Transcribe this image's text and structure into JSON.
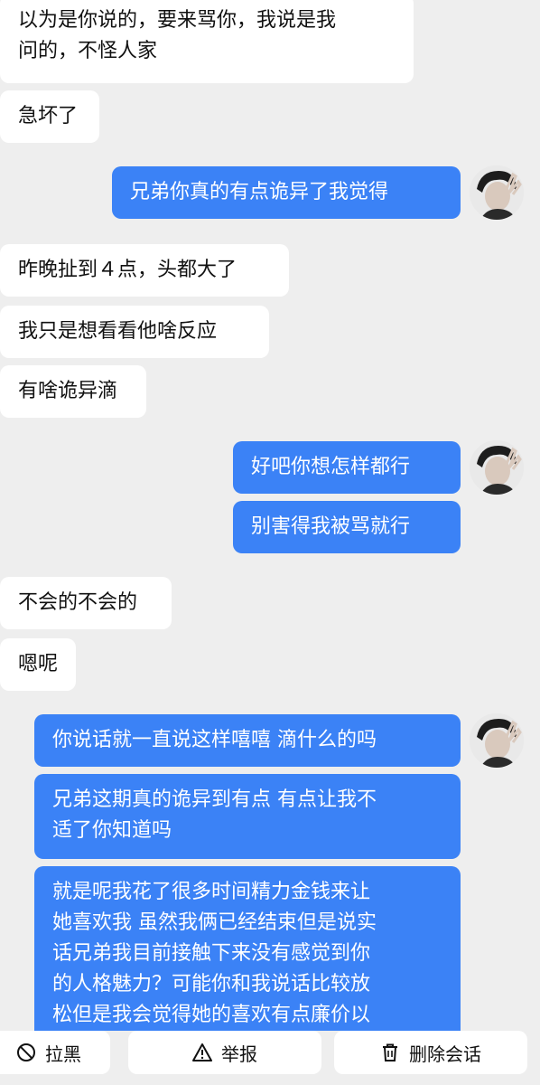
{
  "messages": [
    {
      "side": "in",
      "text": "以为是你说的，要来骂你，我说是我\n问的，不怪人家"
    },
    {
      "side": "in",
      "text": "急坏了"
    },
    {
      "side": "out",
      "text": "兄弟你真的有点诡异了我觉得"
    },
    {
      "side": "in",
      "text": "昨晚扯到４点，头都大了"
    },
    {
      "side": "in",
      "text": "我只是想看看他啥反应"
    },
    {
      "side": "in",
      "text": "有啥诡异滴"
    },
    {
      "side": "out",
      "text": "好吧你想怎样都行"
    },
    {
      "side": "out",
      "text": "别害得我被骂就行"
    },
    {
      "side": "in",
      "text": "不会的不会的"
    },
    {
      "side": "in",
      "text": "嗯呢"
    },
    {
      "side": "out",
      "text": "你说话就一直说这样嘻嘻 滴什么的吗"
    },
    {
      "side": "out",
      "text": "兄弟这期真的诡异到有点 有点让我不\n适了你知道吗"
    },
    {
      "side": "out",
      "text": "就是呢我花了很多时间精力金钱来让\n她喜欢我 虽然我俩已经结束但是说实\n话兄弟我目前接触下来没有感觉到你\n的人格魅力？可能你和我说话比较放\n松但是我会觉得她的喜欢有点廉价以"
    }
  ],
  "bottom_bar": {
    "block_label": "拉黑",
    "report_label": "举报",
    "delete_label": "删除会话"
  },
  "colors": {
    "background": "#eeeeee",
    "outgoing_bubble": "#3b82f6",
    "incoming_bubble": "#ffffff"
  },
  "icons": [
    "block-icon",
    "warning-icon",
    "trash-icon",
    "avatar"
  ]
}
